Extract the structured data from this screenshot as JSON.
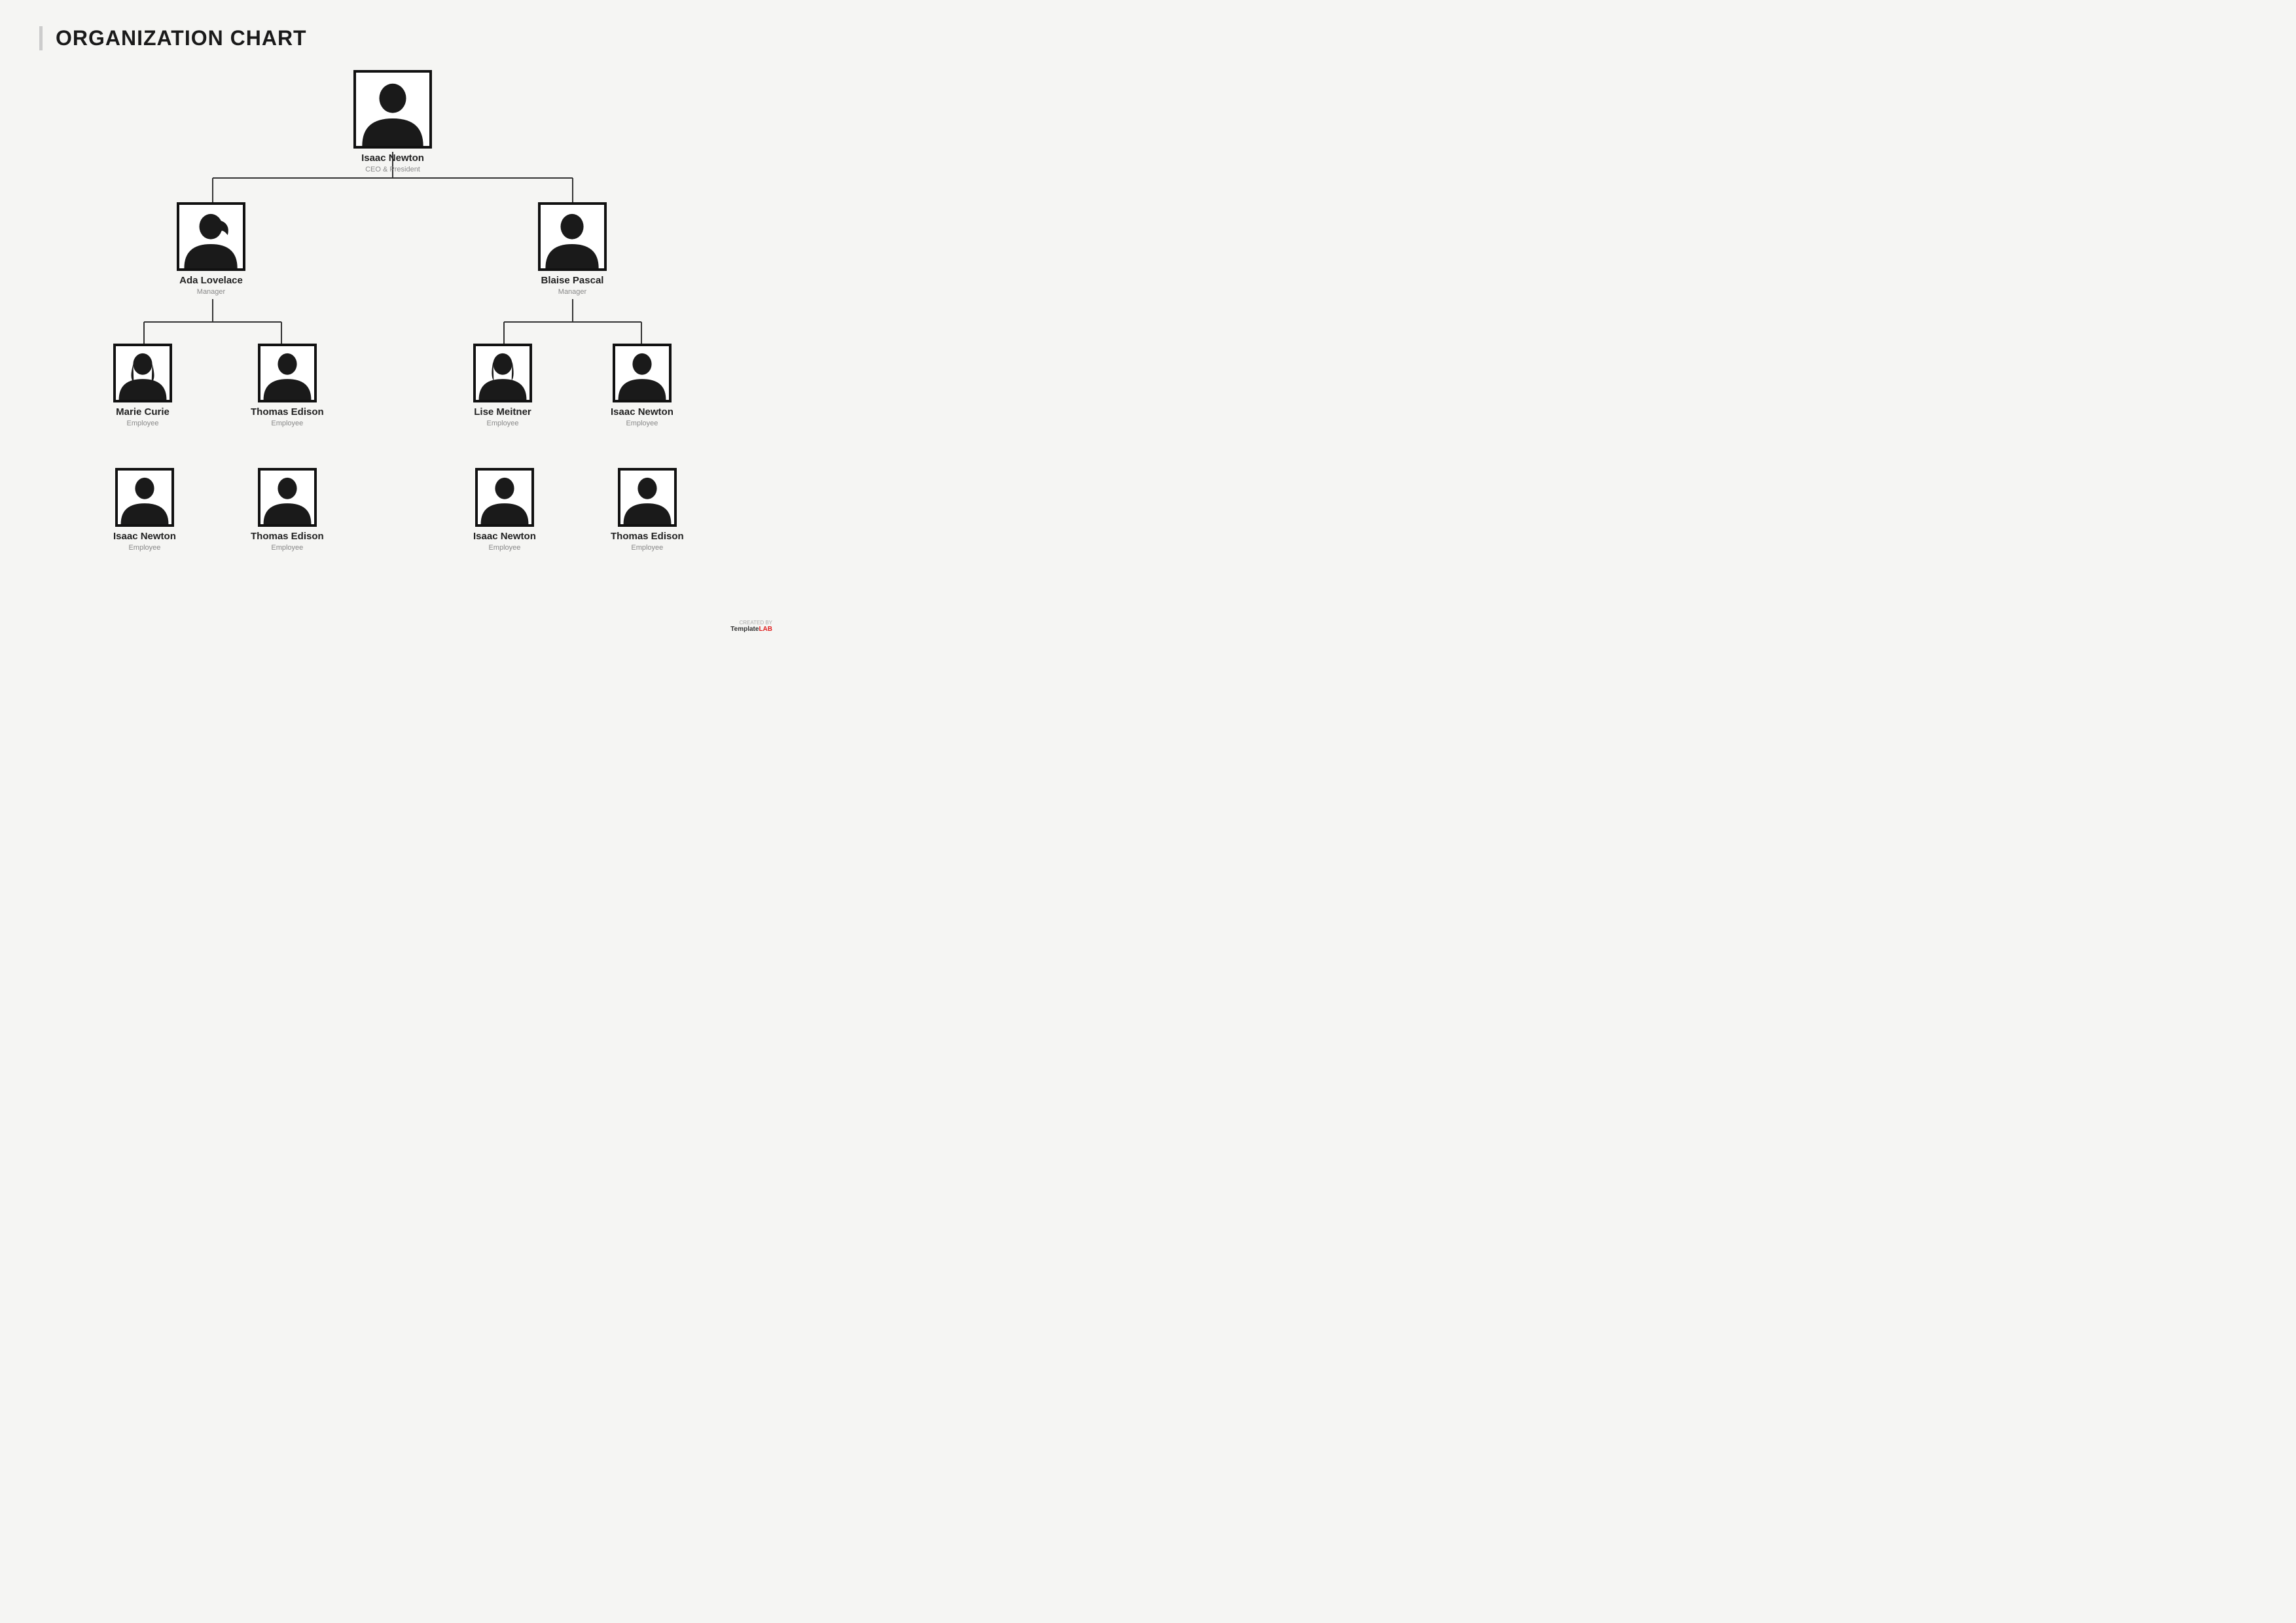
{
  "title": "ORGANIZATION CHART",
  "watermark": {
    "created_by": "CREATED BY",
    "template": "Template",
    "lab": "LAB"
  },
  "nodes": {
    "ceo": {
      "name": "Isaac Newton",
      "title": "CEO & President",
      "size": "large",
      "gender": "male"
    },
    "manager1": {
      "name": "Ada Lovelace",
      "title": "Manager",
      "size": "medium",
      "gender": "female"
    },
    "manager2": {
      "name": "Blaise Pascal",
      "title": "Manager",
      "size": "medium",
      "gender": "male"
    },
    "emp1": {
      "name": "Marie Curie",
      "title": "Employee",
      "size": "small",
      "gender": "female2"
    },
    "emp2": {
      "name": "Thomas Edison",
      "title": "Employee",
      "size": "small",
      "gender": "male2"
    },
    "emp3": {
      "name": "Lise Meitner",
      "title": "Employee",
      "size": "small",
      "gender": "female3"
    },
    "emp4": {
      "name": "Isaac Newton",
      "title": "Employee",
      "size": "small",
      "gender": "male3"
    },
    "emp5": {
      "name": "Isaac Newton",
      "title": "Employee",
      "size": "small",
      "gender": "male4"
    },
    "emp6": {
      "name": "Thomas Edison",
      "title": "Employee",
      "size": "small",
      "gender": "male2"
    },
    "emp7": {
      "name": "Isaac Newton",
      "title": "Employee",
      "size": "small",
      "gender": "male5"
    },
    "emp8": {
      "name": "Thomas Edison",
      "title": "Employee",
      "size": "small",
      "gender": "male3"
    }
  }
}
